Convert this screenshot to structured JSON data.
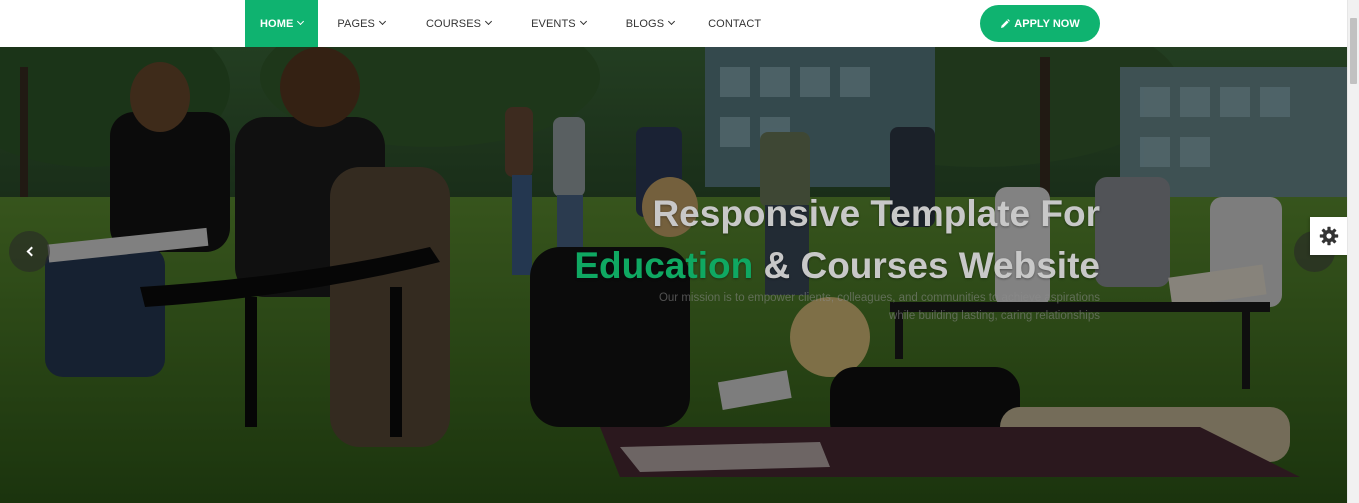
{
  "nav": {
    "home": "HOME",
    "pages": "PAGES",
    "courses": "COURSES",
    "events": "EVENTS",
    "blogs": "BLOGS",
    "contact": "CONTACT"
  },
  "header": {
    "apply_label": "APPLY NOW"
  },
  "hero": {
    "title_line1": "Responsive Template For",
    "title_accent": "Education",
    "title_line2_rest": " & Courses Website",
    "subtitle_line1": "Our mission is to empower clients, colleagues, and communities to achieve aspirations",
    "subtitle_line2": "while building lasting, caring relationships",
    "background_image": "students sitting and lying on campus lawn"
  },
  "colors": {
    "accent": "#0fb370",
    "accent_text": "#0fa862"
  },
  "icons": {
    "nav_dropdown": "chevron-down-icon",
    "apply": "pencil-icon",
    "settings": "gear-icon",
    "slider_prev": "chevron-left-icon",
    "slider_next": "chevron-right-icon"
  }
}
